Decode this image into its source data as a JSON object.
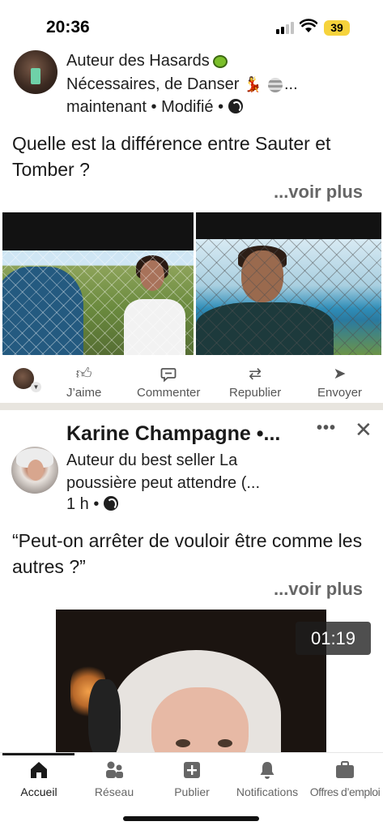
{
  "status_bar": {
    "time": "20:36",
    "battery": "39"
  },
  "post1": {
    "author_line1": "Auteur des Hasards",
    "author_line2_prefix": "Nécessaires, de Danser",
    "author_line2_suffix": "...",
    "timestamp": "maintenant • Modifié •",
    "text": "Quelle est la différence entre Sauter et Tomber ?",
    "see_more": "...voir plus"
  },
  "actions": {
    "like": "J’aime",
    "comment": "Commenter",
    "repost": "Republier",
    "send": "Envoyer"
  },
  "post2": {
    "author_name": "Karine Champagne •...",
    "headline_line1": "Auteur du best seller La",
    "headline_line2": "poussière peut attendre (...",
    "timestamp": "1 h •",
    "text": "“Peut-on arrêter de vouloir être comme les autres ?”",
    "see_more": "...voir plus",
    "video_duration": "01:19"
  },
  "bottom_nav": {
    "items": [
      {
        "label": "Accueil",
        "icon": "home-icon",
        "active": true
      },
      {
        "label": "Réseau",
        "icon": "network-icon",
        "active": false
      },
      {
        "label": "Publier",
        "icon": "publish-icon",
        "active": false
      },
      {
        "label": "Notifications",
        "icon": "bell-icon",
        "active": false
      },
      {
        "label": "Offres d’emploi",
        "icon": "briefcase-icon",
        "active": false
      }
    ]
  }
}
